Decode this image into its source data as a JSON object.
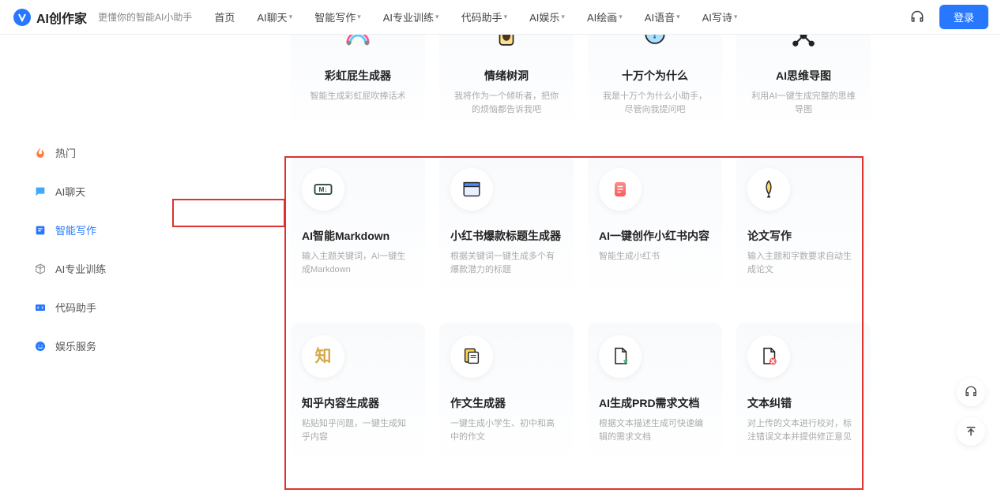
{
  "header": {
    "logo_text": "AI创作家",
    "subtitle": "更懂你的智能AI小助手",
    "nav": [
      "首页",
      "AI聊天",
      "智能写作",
      "AI专业训练",
      "代码助手",
      "AI娱乐",
      "AI绘画",
      "AI语音",
      "AI写诗"
    ],
    "nav_has_chevron": [
      false,
      true,
      true,
      true,
      true,
      true,
      true,
      true,
      true
    ],
    "login": "登录"
  },
  "sidebar": {
    "items": [
      {
        "label": "热门",
        "icon": "fire"
      },
      {
        "label": "AI聊天",
        "icon": "chat"
      },
      {
        "label": "智能写作",
        "icon": "write",
        "active": true
      },
      {
        "label": "AI专业训练",
        "icon": "cube"
      },
      {
        "label": "代码助手",
        "icon": "code"
      },
      {
        "label": "娱乐服务",
        "icon": "smile"
      }
    ]
  },
  "top_cards": [
    {
      "title": "彩虹屁生成器",
      "desc": "智能生成彩虹屁吹捧话术",
      "icon": "rainbow"
    },
    {
      "title": "情绪树洞",
      "desc": "我将作为一个倾听者，把你的烦恼都告诉我吧",
      "icon": "hole"
    },
    {
      "title": "十万个为什么",
      "desc": "我是十万个为什么小助手，尽管向我提问吧",
      "icon": "question"
    },
    {
      "title": "AI思维导图",
      "desc": "利用AI一键生成完整的思维导图",
      "icon": "mindmap"
    }
  ],
  "mid_cards": [
    {
      "title": "AI智能Markdown",
      "desc": "输入主题关键词，AI一键生成Markdown",
      "icon": "md"
    },
    {
      "title": "小红书爆款标题生成器",
      "desc": "根据关键词一键生成多个有爆款潜力的标题",
      "icon": "window"
    },
    {
      "title": "AI一键创作小红书内容",
      "desc": "智能生成小红书",
      "icon": "note"
    },
    {
      "title": "论文写作",
      "desc": "输入主题和字数要求自动生成论文",
      "icon": "pen"
    }
  ],
  "bot_cards": [
    {
      "title": "知乎内容生成器",
      "desc": "粘贴知乎问题，一键生成知乎内容",
      "icon": "zhi"
    },
    {
      "title": "作文生成器",
      "desc": "一键生成小学生、初中和高中的作文",
      "icon": "doc"
    },
    {
      "title": "AI生成PRD需求文档",
      "desc": "根据文本描述生成可快速编辑的需求文档",
      "icon": "prd"
    },
    {
      "title": "文本纠错",
      "desc": "对上传的文本进行校对，标注错误文本并提供修正意见",
      "icon": "error"
    }
  ]
}
